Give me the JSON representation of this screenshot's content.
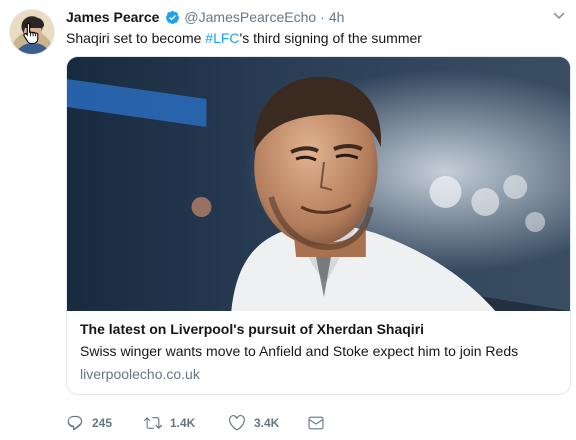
{
  "tweet": {
    "author_name": "James Pearce",
    "handle": "@JamesPearceEcho",
    "separator": "·",
    "time": "4h",
    "text_before": "Shaqiri set to become ",
    "hashtag": "#LFC",
    "text_after": "'s third signing of the summer"
  },
  "card": {
    "title": "The latest on Liverpool's pursuit of Xherdan Shaqiri",
    "description": "Swiss winger wants move to Anfield and Stoke expect him to join Reds",
    "domain": "liverpoolecho.co.uk"
  },
  "actions": {
    "replies": "245",
    "retweets": "1.4K",
    "likes": "3.4K"
  },
  "icons": {
    "verified": "verified-badge-icon",
    "caret": "chevron-down-icon",
    "reply": "reply-icon",
    "retweet": "retweet-icon",
    "like": "heart-icon",
    "message": "envelope-icon"
  },
  "colors": {
    "accent": "#1da1f2",
    "text": "#14171a",
    "muted": "#657786",
    "border": "#e1e8ed"
  }
}
